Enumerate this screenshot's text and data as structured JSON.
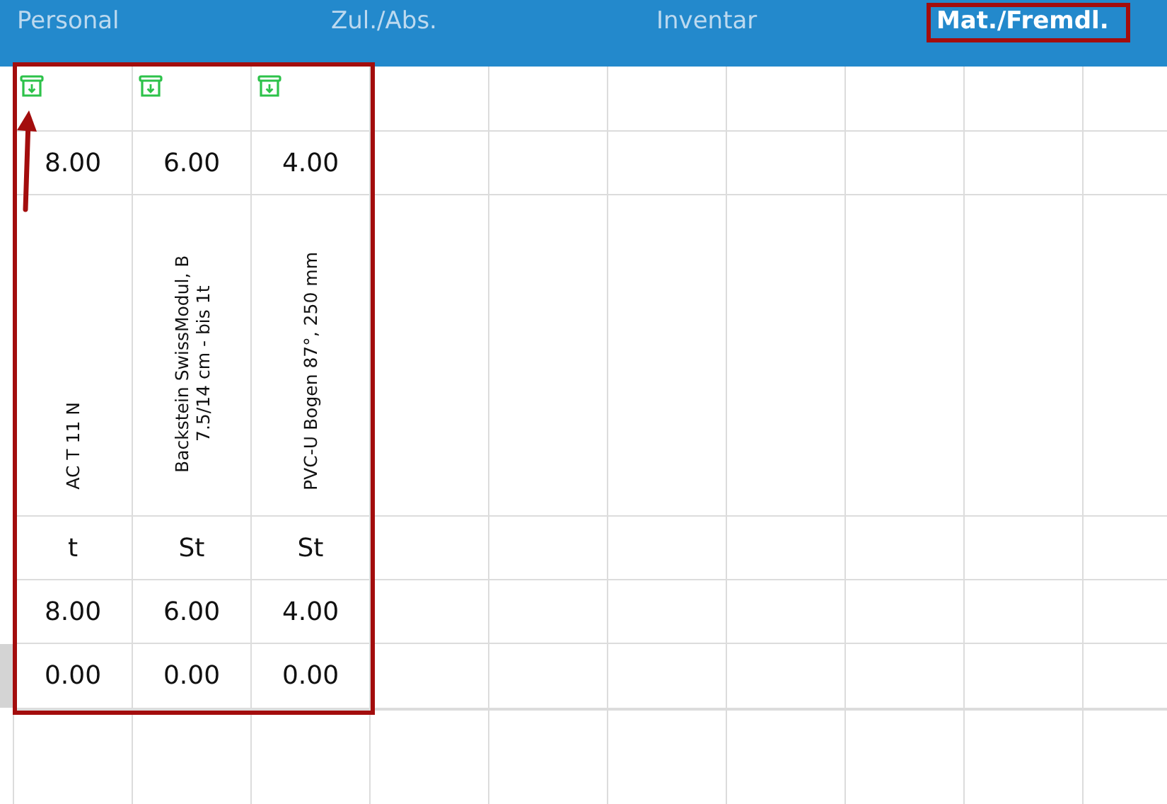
{
  "tabs": [
    {
      "label": "Personal",
      "selected": false
    },
    {
      "label": "Zul./Abs.",
      "selected": false
    },
    {
      "label": "Inventar",
      "selected": false
    },
    {
      "label": "Mat./Fremdl.",
      "selected": true
    }
  ],
  "columns": [
    {
      "quantity": "8.00",
      "name": "AC T 11 N",
      "unit": "t",
      "value_1": "8.00",
      "value_2": "0.00"
    },
    {
      "quantity": "6.00",
      "name": "Backstein SwissModul, B 7.5/14 cm - bis 1t",
      "unit": "St",
      "value_1": "6.00",
      "value_2": "0.00"
    },
    {
      "quantity": "4.00",
      "name": "PVC-U Bogen 87°, 250 mm",
      "unit": "St",
      "value_1": "4.00",
      "value_2": "0.00"
    }
  ]
}
